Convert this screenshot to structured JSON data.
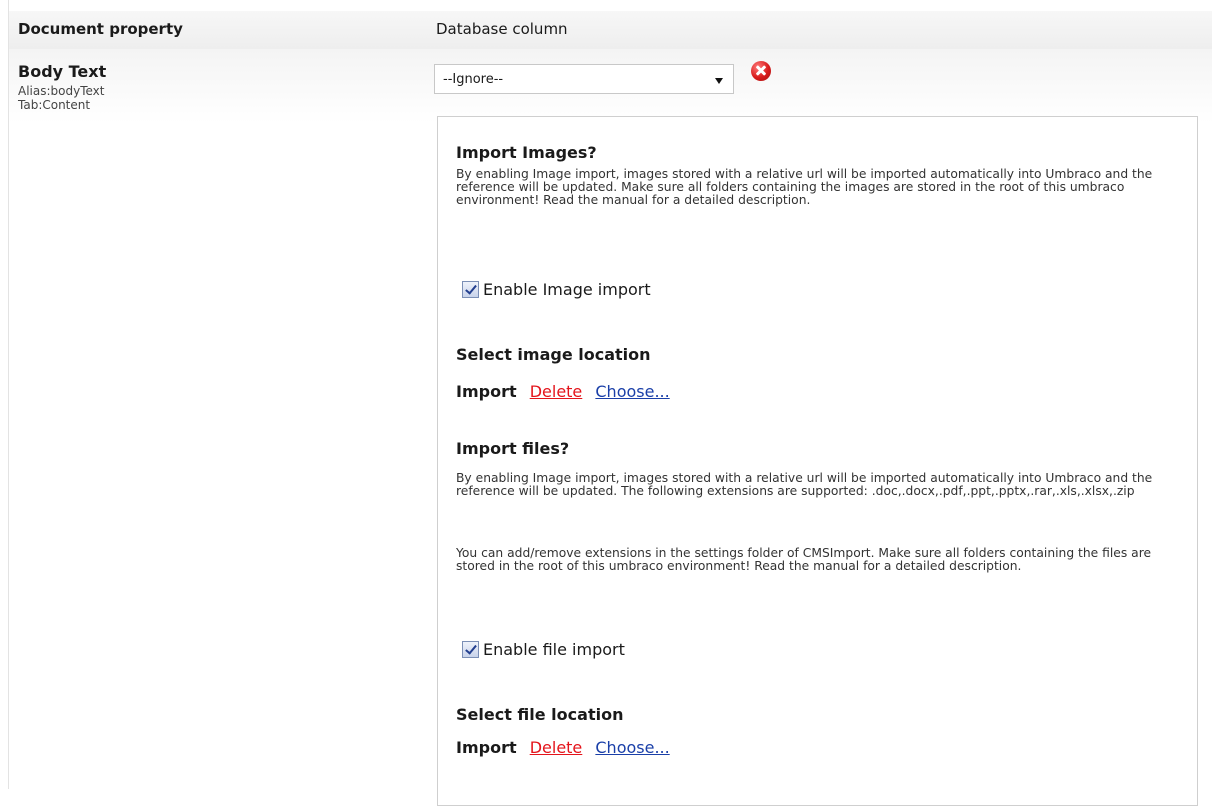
{
  "header": {
    "document_property": "Document property",
    "database_column": "Database column"
  },
  "property": {
    "name": "Body Text",
    "alias": "Alias:bodyText",
    "tab": "Tab:Content"
  },
  "column_select": {
    "selected": "--Ignore--",
    "remove_icon": "remove-icon"
  },
  "images": {
    "title": "Import Images?",
    "description": "By enabling Image import, images stored with a relative url will be imported automatically into Umbraco and the reference will be updated. Make sure all folders containing the images are stored in the root of this umbraco environment! Read the manual for a detailed description.",
    "checkbox_label": "Enable Image import",
    "checked": true,
    "location_title": "Select image location",
    "import_label": "Import",
    "delete_label": "Delete",
    "choose_label": "Choose..."
  },
  "files": {
    "title": "Import files?",
    "description": "By enabling Image import, images stored with a relative url will be imported automatically into Umbraco and the reference will be updated. The following extensions are supported: .doc,.docx,.pdf,.ppt,.pptx,.rar,.xls,.xlsx,.zip",
    "note": "You can add/remove extensions in the settings folder of CMSImport. Make sure all folders containing the files are stored in the root of this umbraco environment! Read the manual for a detailed description.",
    "checkbox_label": "Enable file import",
    "checked": true,
    "location_title": "Select file location",
    "import_label": "Import",
    "delete_label": "Delete",
    "choose_label": "Choose..."
  },
  "colors": {
    "delete_link": "#e4141b",
    "choose_link": "#1a3fa8",
    "remove_icon": "#d81c1c"
  }
}
